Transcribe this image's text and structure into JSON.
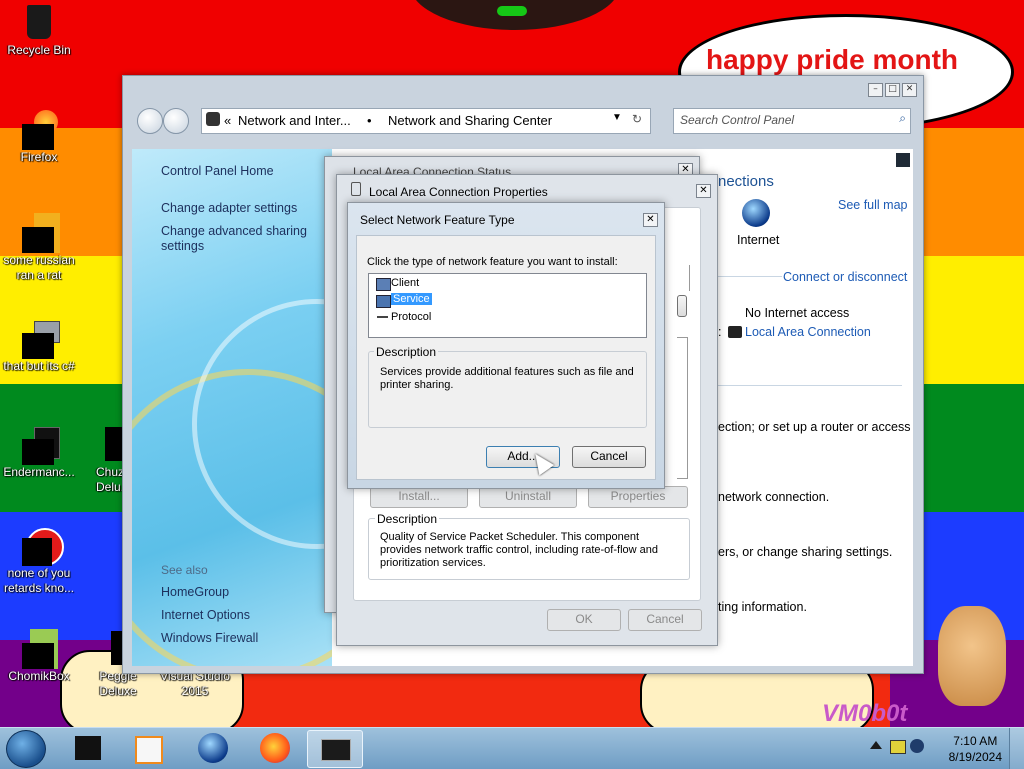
{
  "desktop": {
    "bubble_text": "happy pride month",
    "watermark": "VM0b0t",
    "icons": [
      {
        "label": "Recycle Bin"
      },
      {
        "label": "Firefox"
      },
      {
        "label": "some russian ran a rat"
      },
      {
        "label": "that but its c#"
      },
      {
        "label": "Endermanc..."
      },
      {
        "label": "Chuz... Delu..."
      },
      {
        "label": "none of you retards kno..."
      },
      {
        "label": "ChomikBox"
      },
      {
        "label": "Peggle Deluxe"
      },
      {
        "label": "Visual Studio 2015"
      }
    ]
  },
  "explorer": {
    "breadcrumb_chevron": "«",
    "breadcrumb_parent": "Network and Inter...",
    "breadcrumb_sep": "•",
    "breadcrumb_current": "Network and Sharing Center",
    "search_placeholder": "Search Control Panel",
    "left_links": [
      "Control Panel Home",
      "Change adapter settings",
      "Change advanced sharing settings"
    ],
    "see_also_heading": "See also",
    "see_also_links": [
      "HomeGroup",
      "Internet Options",
      "Windows Firewall"
    ],
    "right": {
      "connections_heading_partial": "nections",
      "see_full_map": "See full map",
      "internet_label": "Internet",
      "connect_disconnect": "Connect or disconnect",
      "no_internet": "No Internet access",
      "local_area_connection": "Local Area Connection",
      "text_router": "ection; or set up a router or access",
      "text_network_connection": "network connection.",
      "text_sharing": "ers, or change sharing settings.",
      "text_info": "ting information."
    }
  },
  "status_dialog": {
    "title_partial": "Local Area Connection Status"
  },
  "properties_dialog": {
    "title": "Local Area Connection Properties",
    "install_button": "Install...",
    "uninstall_button": "Uninstall",
    "properties_button": "Properties",
    "description_label": "Description",
    "description_text": "Quality of Service Packet Scheduler.  This component provides network traffic control, including rate-of-flow and prioritization services.",
    "ok_button": "OK",
    "cancel_button": "Cancel"
  },
  "feature_dialog": {
    "title": "Select Network Feature Type",
    "instruction": "Click the type of network feature you want to install:",
    "items": [
      "Client",
      "Service",
      "Protocol"
    ],
    "selected_item": "Service",
    "description_label": "Description",
    "description_text": "Services provide additional features such as file and printer sharing.",
    "add_button": "Add...",
    "cancel_button": "Cancel"
  },
  "taskbar": {
    "time": "7:10 AM",
    "date": "8/19/2024"
  },
  "colors": {
    "rainbow": [
      "#f00000",
      "#ff8c00",
      "#ffee00",
      "#008a1e",
      "#1c3cff",
      "#73008a"
    ],
    "bubble_text": "#e31515",
    "link": "#1d5bb5",
    "selected_item": "#3399ff"
  }
}
